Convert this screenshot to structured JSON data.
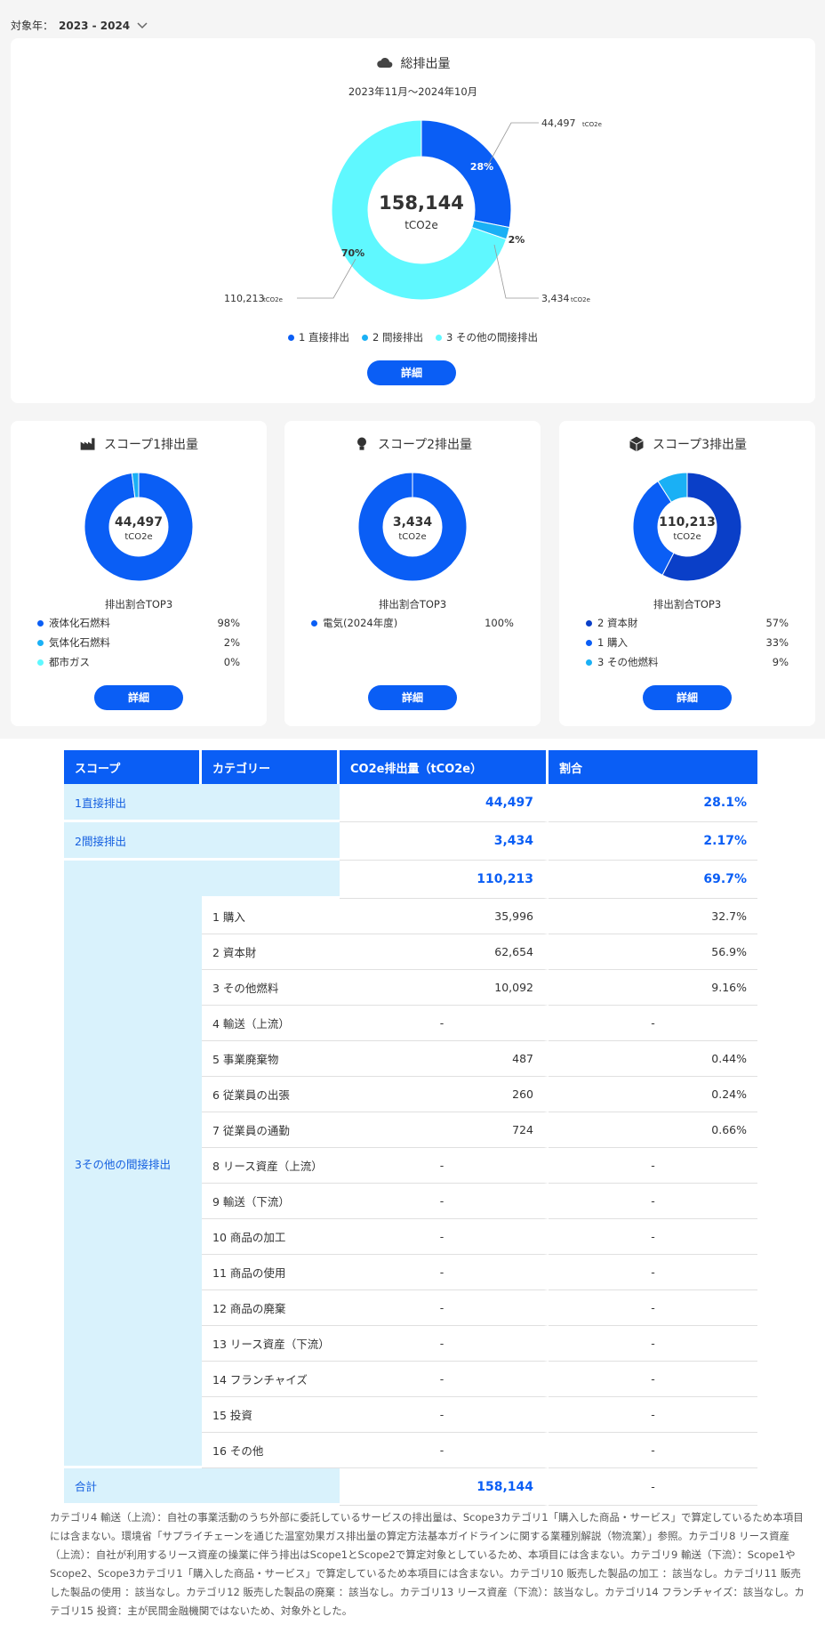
{
  "year_selector": {
    "label": "対象年：",
    "value": "2023 - 2024"
  },
  "total": {
    "title": "総排出量",
    "period": "2023年11月～2024年10月",
    "center_value": "158,144",
    "center_unit": "tCO2e",
    "segments": [
      {
        "name": "1 直接排出",
        "percent_label": "28%",
        "value_label": "44,497",
        "unit": "tCO2e",
        "share": 28.1,
        "color": "#0a5ef5"
      },
      {
        "name": "2 間接排出",
        "percent_label": "2%",
        "value_label": "3,434",
        "unit": "tCO2e",
        "share": 2.17,
        "color": "#1ab0f5"
      },
      {
        "name": "3 その他の間接排出",
        "percent_label": "70%",
        "value_label": "110,213",
        "unit": "tCO2e",
        "share": 69.7,
        "color": "#5ff8ff"
      }
    ],
    "button": "詳細"
  },
  "scope1": {
    "title": "スコープ1排出量",
    "center_value": "44,497",
    "center_unit": "tCO2e",
    "top3_label": "排出割合TOP3",
    "items": [
      {
        "name": "液体化石燃料",
        "percent": "98%",
        "share": 98,
        "color": "#0a5ef5"
      },
      {
        "name": "気体化石燃料",
        "percent": "2%",
        "share": 2,
        "color": "#1ab0f5"
      },
      {
        "name": "都市ガス",
        "percent": "0%",
        "share": 0,
        "color": "#5ff8ff"
      }
    ],
    "button": "詳細"
  },
  "scope2": {
    "title": "スコープ2排出量",
    "center_value": "3,434",
    "center_unit": "tCO2e",
    "top3_label": "排出割合TOP3",
    "items": [
      {
        "name": "電気(2024年度)",
        "percent": "100%",
        "share": 100,
        "color": "#0a5ef5"
      }
    ],
    "button": "詳細"
  },
  "scope3": {
    "title": "スコープ3排出量",
    "center_value": "110,213",
    "center_unit": "tCO2e",
    "top3_label": "排出割合TOP3",
    "items": [
      {
        "name": "2 資本財",
        "percent": "57%",
        "share": 57,
        "color": "#0a3fc8"
      },
      {
        "name": "1 購入",
        "percent": "33%",
        "share": 33,
        "color": "#0a5ef5"
      },
      {
        "name": "3 その他燃料",
        "percent": "9%",
        "share": 9,
        "color": "#1ab0f5"
      }
    ],
    "button": "詳細"
  },
  "table": {
    "headers": [
      "スコープ",
      "カテゴリー",
      "CO2e排出量（tCO2e）",
      "割合"
    ],
    "scope1": {
      "label": "1直接排出",
      "value": "44,497",
      "ratio": "28.1%"
    },
    "scope2": {
      "label": "2間接排出",
      "value": "3,434",
      "ratio": "2.17%"
    },
    "scope3": {
      "label": "3その他の間接排出",
      "value": "110,213",
      "ratio": "69.7%"
    },
    "categories": [
      {
        "name": "1 購入",
        "value": "35,996",
        "ratio": "32.7%"
      },
      {
        "name": "2 資本財",
        "value": "62,654",
        "ratio": "56.9%"
      },
      {
        "name": "3 その他燃料",
        "value": "10,092",
        "ratio": "9.16%"
      },
      {
        "name": "4 輸送（上流）",
        "value": "-",
        "ratio": "-"
      },
      {
        "name": "5 事業廃棄物",
        "value": "487",
        "ratio": "0.44%"
      },
      {
        "name": "6 従業員の出張",
        "value": "260",
        "ratio": "0.24%"
      },
      {
        "name": "7 従業員の通勤",
        "value": "724",
        "ratio": "0.66%"
      },
      {
        "name": "8 リース資産（上流）",
        "value": "-",
        "ratio": "-"
      },
      {
        "name": "9 輸送（下流）",
        "value": "-",
        "ratio": "-"
      },
      {
        "name": "10 商品の加工",
        "value": "-",
        "ratio": "-"
      },
      {
        "name": "11 商品の使用",
        "value": "-",
        "ratio": "-"
      },
      {
        "name": "12 商品の廃棄",
        "value": "-",
        "ratio": "-"
      },
      {
        "name": "13 リース資産（下流）",
        "value": "-",
        "ratio": "-"
      },
      {
        "name": "14 フランチャイズ",
        "value": "-",
        "ratio": "-"
      },
      {
        "name": "15 投資",
        "value": "-",
        "ratio": "-"
      },
      {
        "name": "16 その他",
        "value": "-",
        "ratio": "-"
      }
    ],
    "total": {
      "label": "合計",
      "value": "158,144",
      "ratio": "-"
    }
  },
  "footnote": "カテゴリ4 輸送（上流）：自社の事業活動のうち外部に委託しているサービスの排出量は、Scope3カテゴリ1「購入した商品・サービス」で算定しているため本項目には含まない。環境省「サプライチェーンを通じた温室効果ガス排出量の算定方法基本ガイドラインに関する業種別解説（物流業）」参照。カテゴリ8 リース資産（上流）：自社が利用するリース資産の操業に伴う排出はScope1とScope2で算定対象としているため、本項目には含まない。カテゴリ9 輸送（下流）：Scope1やScope2、Scope3カテゴリ1「購入した商品・サービス」で算定しているため本項目には含まない。カテゴリ10 販売した製品の加工 ：該当なし。カテゴリ11 販売した製品の使用 ：該当なし。カテゴリ12 販売した製品の廃棄 ：該当なし。カテゴリ13 リース資産（下流）：該当なし。カテゴリ14 フランチャイズ：該当なし。カテゴリ15 投資：主が民間金融機関ではないため、対象外とした。"
}
